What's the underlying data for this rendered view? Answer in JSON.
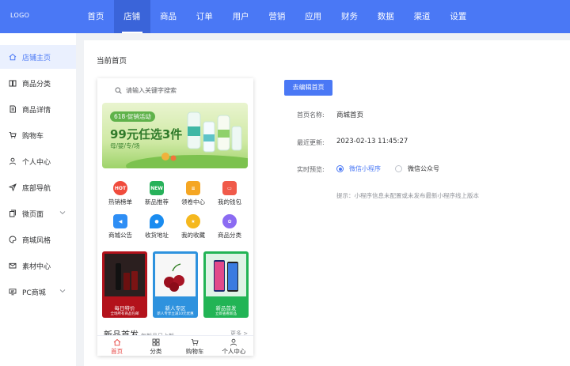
{
  "header": {
    "logo": "LOGO",
    "nav": [
      "首页",
      "店铺",
      "商品",
      "订单",
      "用户",
      "营销",
      "应用",
      "财务",
      "数据",
      "渠道",
      "设置"
    ],
    "active_nav": "店铺"
  },
  "sidebar": {
    "items": [
      {
        "label": "店铺主页",
        "icon": "home-icon",
        "active": true
      },
      {
        "label": "商品分类",
        "icon": "book-icon"
      },
      {
        "label": "商品详情",
        "icon": "document-icon"
      },
      {
        "label": "购物车",
        "icon": "cart-icon"
      },
      {
        "label": "个人中心",
        "icon": "user-icon"
      },
      {
        "label": "底部导航",
        "icon": "send-icon"
      },
      {
        "label": "微页面",
        "icon": "pages-icon",
        "expandable": true
      },
      {
        "label": "商城风格",
        "icon": "palette-icon"
      },
      {
        "label": "素材中心",
        "icon": "mail-icon"
      },
      {
        "label": "PC商城",
        "icon": "monitor-icon",
        "expandable": true
      }
    ]
  },
  "main": {
    "breadcrumb": "当前首页",
    "edit_button": "去编辑首页",
    "fields": {
      "name_label": "首页名称:",
      "name_value": "商城首页",
      "updated_label": "最近更新:",
      "updated_value": "2023-02-13 11:45:27",
      "preview_label": "实时预览:",
      "preview_options": [
        "微信小程序",
        "微信公众号"
      ],
      "preview_selected": "微信小程序"
    },
    "tip": "提示：小程序信息未配置或未发布最新小程序线上版本"
  },
  "phone": {
    "search_placeholder": "请输入关键字搜索",
    "banner": {
      "tag": "618·促销活动",
      "headline": "99元任选3件",
      "sub": "母/婴/专/场"
    },
    "grid": [
      {
        "label": "热销榜单",
        "icon": "hot-icon",
        "badge": "HOT",
        "color": "#f04b3c"
      },
      {
        "label": "新品推荐",
        "icon": "new-icon",
        "badge": "NEW",
        "color": "#27b15a"
      },
      {
        "label": "领卷中心",
        "icon": "coupon-icon",
        "badge": "",
        "color": "#f5a623"
      },
      {
        "label": "我的钱包",
        "icon": "wallet-icon",
        "badge": "",
        "color": "#f05a4a"
      },
      {
        "label": "商城公告",
        "icon": "notice-icon",
        "badge": "",
        "color": "#2e8ef5"
      },
      {
        "label": "收货地址",
        "icon": "location-icon",
        "badge": "",
        "color": "#1a8cf0"
      },
      {
        "label": "我的收藏",
        "icon": "star-icon",
        "badge": "",
        "color": "#f5b81e"
      },
      {
        "label": "商品分类",
        "icon": "category-icon",
        "badge": "",
        "color": "#8b6bf2"
      }
    ],
    "cards": [
      {
        "title": "每日特价",
        "sub": "全场所有商品包邮",
        "bg": "#b3121b",
        "top": "#2b1f1f"
      },
      {
        "title": "新人专区",
        "sub": "新人专享立减10元优惠",
        "bg": "#2e92de",
        "top": "#f7f7f7"
      },
      {
        "title": "新品首发",
        "sub": "立即查看新品",
        "bg": "#22b455",
        "top": "#dff3e6"
      }
    ],
    "new_section": {
      "title": "新品首发",
      "sub": "每新品日上新",
      "more": "更多 >"
    },
    "tabs": [
      {
        "label": "首页",
        "icon": "home-tab-icon",
        "active": true
      },
      {
        "label": "分类",
        "icon": "grid-tab-icon"
      },
      {
        "label": "购物车",
        "icon": "cart-tab-icon"
      },
      {
        "label": "个人中心",
        "icon": "user-tab-icon"
      }
    ]
  }
}
